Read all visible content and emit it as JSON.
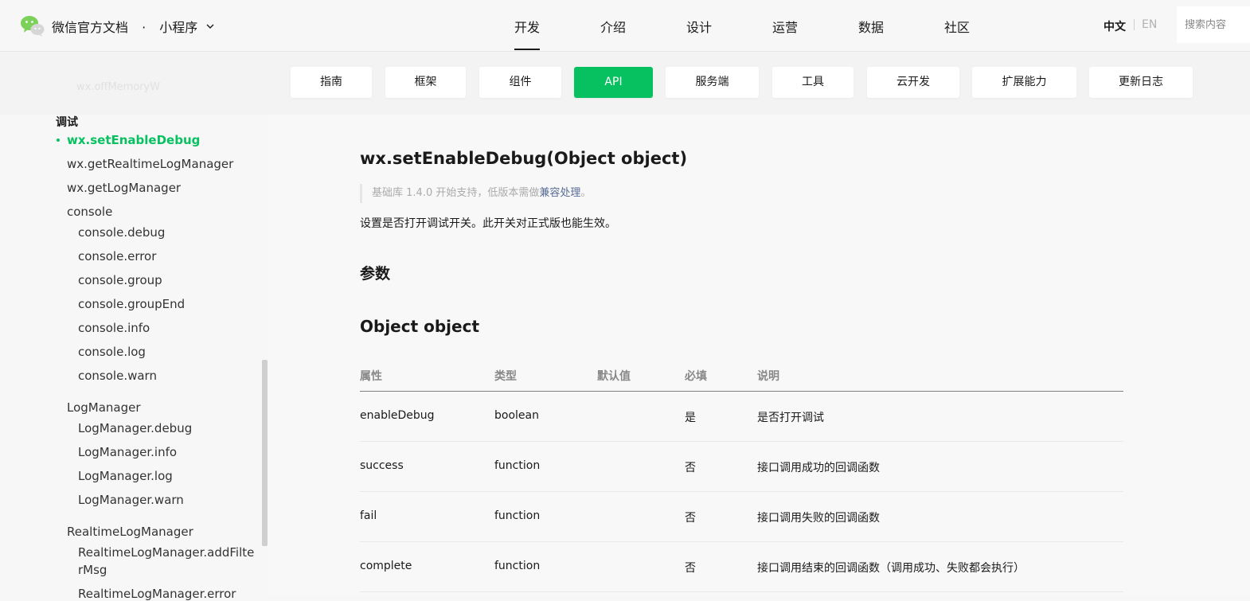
{
  "header": {
    "brand": "微信官方文档",
    "separator": "·",
    "product": "小程序",
    "nav": [
      {
        "label": "开发"
      },
      {
        "label": "介绍"
      },
      {
        "label": "设计"
      },
      {
        "label": "运营"
      },
      {
        "label": "数据"
      },
      {
        "label": "社区"
      }
    ],
    "lang_zh": "中文",
    "lang_en": "EN",
    "search_placeholder": "搜索内容"
  },
  "subnav": {
    "ghost_text": "wx.offMemoryW",
    "tabs": [
      {
        "label": "指南"
      },
      {
        "label": "框架"
      },
      {
        "label": "组件"
      },
      {
        "label": "API"
      },
      {
        "label": "服务端"
      },
      {
        "label": "工具"
      },
      {
        "label": "云开发"
      },
      {
        "label": "扩展能力"
      },
      {
        "label": "更新日志"
      }
    ]
  },
  "sidebar": {
    "group": "调试",
    "items": [
      {
        "label": "wx.setEnableDebug"
      },
      {
        "label": "wx.getRealtimeLogManager"
      },
      {
        "label": "wx.getLogManager"
      },
      {
        "label": "console"
      },
      {
        "label": "console.debug"
      },
      {
        "label": "console.error"
      },
      {
        "label": "console.group"
      },
      {
        "label": "console.groupEnd"
      },
      {
        "label": "console.info"
      },
      {
        "label": "console.log"
      },
      {
        "label": "console.warn"
      },
      {
        "label": "LogManager"
      },
      {
        "label": "LogManager.debug"
      },
      {
        "label": "LogManager.info"
      },
      {
        "label": "LogManager.log"
      },
      {
        "label": "LogManager.warn"
      },
      {
        "label": "RealtimeLogManager"
      },
      {
        "label": "RealtimeLogManager.addFilte"
      },
      {
        "label": "rMsg"
      },
      {
        "label": "RealtimeLogManager.error"
      }
    ]
  },
  "main": {
    "title": "wx.setEnableDebug(Object object)",
    "note_prefix": "基础库 1.4.0 开始支持，低版本需做",
    "note_link": "兼容处理",
    "note_suffix": "。",
    "description": "设置是否打开调试开关。此开关对正式版也能生效。",
    "params_heading": "参数",
    "object_heading": "Object object",
    "table": {
      "headers": [
        "属性",
        "类型",
        "默认值",
        "必填",
        "说明"
      ],
      "rows": [
        {
          "name": "enableDebug",
          "type": "boolean",
          "default": "",
          "required": "是",
          "desc": "是否打开调试"
        },
        {
          "name": "success",
          "type": "function",
          "default": "",
          "required": "否",
          "desc": "接口调用成功的回调函数"
        },
        {
          "name": "fail",
          "type": "function",
          "default": "",
          "required": "否",
          "desc": "接口调用失败的回调函数"
        },
        {
          "name": "complete",
          "type": "function",
          "default": "",
          "required": "否",
          "desc": "接口调用结束的回调函数（调用成功、失败都会执行）"
        }
      ]
    }
  },
  "colors": {
    "accent": "#07c160",
    "link": "#576b95"
  }
}
